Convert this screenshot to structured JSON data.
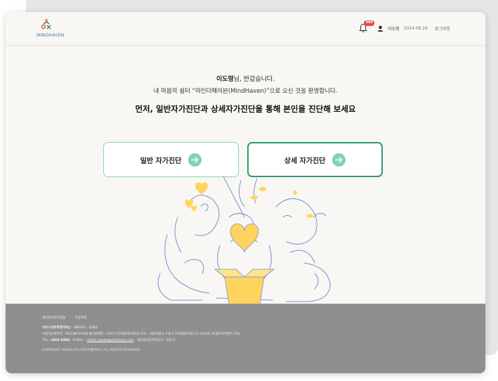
{
  "header": {
    "logo_text": "MINDHAVEN",
    "notification_badge": "999",
    "user_name": "이도령",
    "date": "2024.08.26",
    "logout_label": "로그아웃"
  },
  "main": {
    "greeting_name": "이도령",
    "greeting_suffix": "님, 반갑습니다.",
    "welcome_text": "내 마음의 쉼터 “마인더해이븐(MindHaven)”으로 오신 것을 환영합니다.",
    "headline": "먼저, 일반자가진단과 상세자가진단을 통해 본인을 진단해 보세요",
    "button_general": "일반 자가진단",
    "button_detail": "상세 자가진단"
  },
  "footer": {
    "privacy_link": "개인정보처리방침",
    "terms_link": "이용약관",
    "company_name": "(주)스마트마켓서비스",
    "ceo": "대표이사 : 김세규",
    "address_line": "사업자등록번호 : 852-88-01968   통신판매업 : 2021-부산해운대-0814   주소 : 서울특별시 구로구 디지털로33길 12 1203호 (우림이비지센터 2차)",
    "tel_label": "TEL : ",
    "tel": "1661-0282",
    "email_label": "E-MAIL : ",
    "email": "smart_market@smbusan.com",
    "privacy_officer": "개인정보관리책임자 : 김민식",
    "copyright": "COPYRIGHT ©2024 (주)스마트마켓서비스 ALL RIGHTS RESERVED"
  },
  "colors": {
    "accent_green": "#2f9a6e",
    "light_green": "#8fd1b3",
    "badge_red": "#e5484d",
    "heart_yellow": "#ffd45e",
    "line_blue": "#7a8fd6",
    "footer_gray": "#8f8f8f"
  },
  "icons": [
    "bell-icon",
    "avatar-icon",
    "arrow-right-icon",
    "logo-icon"
  ]
}
